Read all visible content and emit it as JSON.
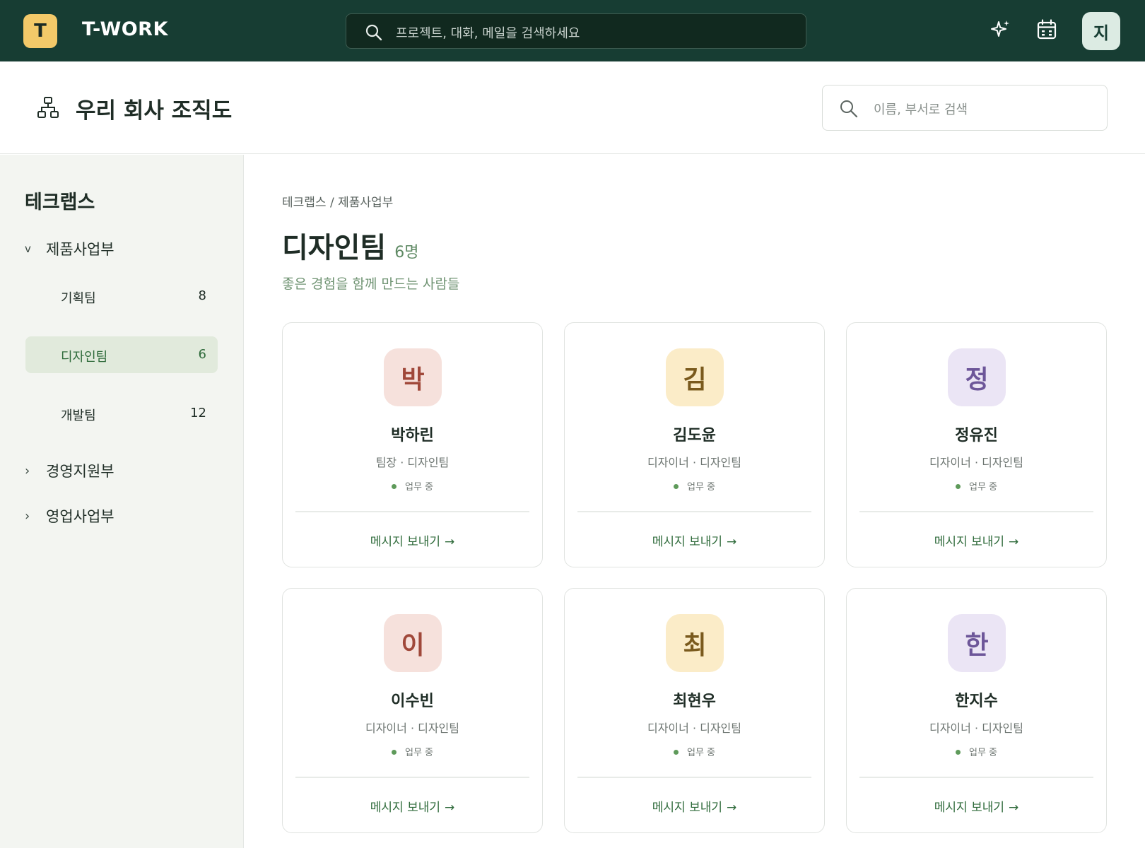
{
  "app": {
    "logo_letter": "T",
    "brand": "T-WORK",
    "search_placeholder": "프로젝트, 대화, 메일을 검색하세요",
    "user_initial": "지"
  },
  "header": {
    "title": "우리 회사 조직도",
    "search_placeholder": "이름, 부서로 검색"
  },
  "sidebar": {
    "company": "테크랩스",
    "groups": [
      {
        "label": "제품사업부",
        "expanded": true,
        "chevron": "v"
      },
      {
        "label": "경영지원부",
        "expanded": false,
        "chevron": "›"
      },
      {
        "label": "영업사업부",
        "expanded": false,
        "chevron": "›"
      }
    ],
    "teams": [
      {
        "label": "기획팀",
        "count": "8"
      },
      {
        "label": "디자인팀",
        "count": "6",
        "active": true
      },
      {
        "label": "개발팀",
        "count": "12"
      }
    ]
  },
  "main": {
    "breadcrumb": "테크랩스 / 제품사업부",
    "team_name": "디자인팀",
    "member_count": "6명",
    "tagline": "좋은 경험을 함께 만드는 사람들",
    "message_label": "메시지 보내기",
    "arrow": "→",
    "members": [
      {
        "initial": "박",
        "name": "박하린",
        "role": "팀장 · 디자인팀",
        "status": "업무 중",
        "bg": "#f6e1dc",
        "fg": "#a0483a"
      },
      {
        "initial": "김",
        "name": "김도윤",
        "role": "디자이너 · 디자인팀",
        "status": "업무 중",
        "bg": "#fbecc8",
        "fg": "#7a5a1d"
      },
      {
        "initial": "정",
        "name": "정유진",
        "role": "디자이너 · 디자인팀",
        "status": "업무 중",
        "bg": "#ebe5f5",
        "fg": "#6d5699"
      },
      {
        "initial": "이",
        "name": "이수빈",
        "role": "디자이너 · 디자인팀",
        "status": "업무 중",
        "bg": "#f6e1dc",
        "fg": "#a0483a"
      },
      {
        "initial": "최",
        "name": "최현우",
        "role": "디자이너 · 디자인팀",
        "status": "업무 중",
        "bg": "#fbecc8",
        "fg": "#7a5a1d"
      },
      {
        "initial": "한",
        "name": "한지수",
        "role": "디자이너 · 디자인팀",
        "status": "업무 중",
        "bg": "#ebe5f5",
        "fg": "#6d5699"
      }
    ]
  },
  "colors": {
    "topbar": "#173d33",
    "accent": "#2f6b3b",
    "status_dot": "#5e9a5a",
    "logo": "#f3c969"
  }
}
